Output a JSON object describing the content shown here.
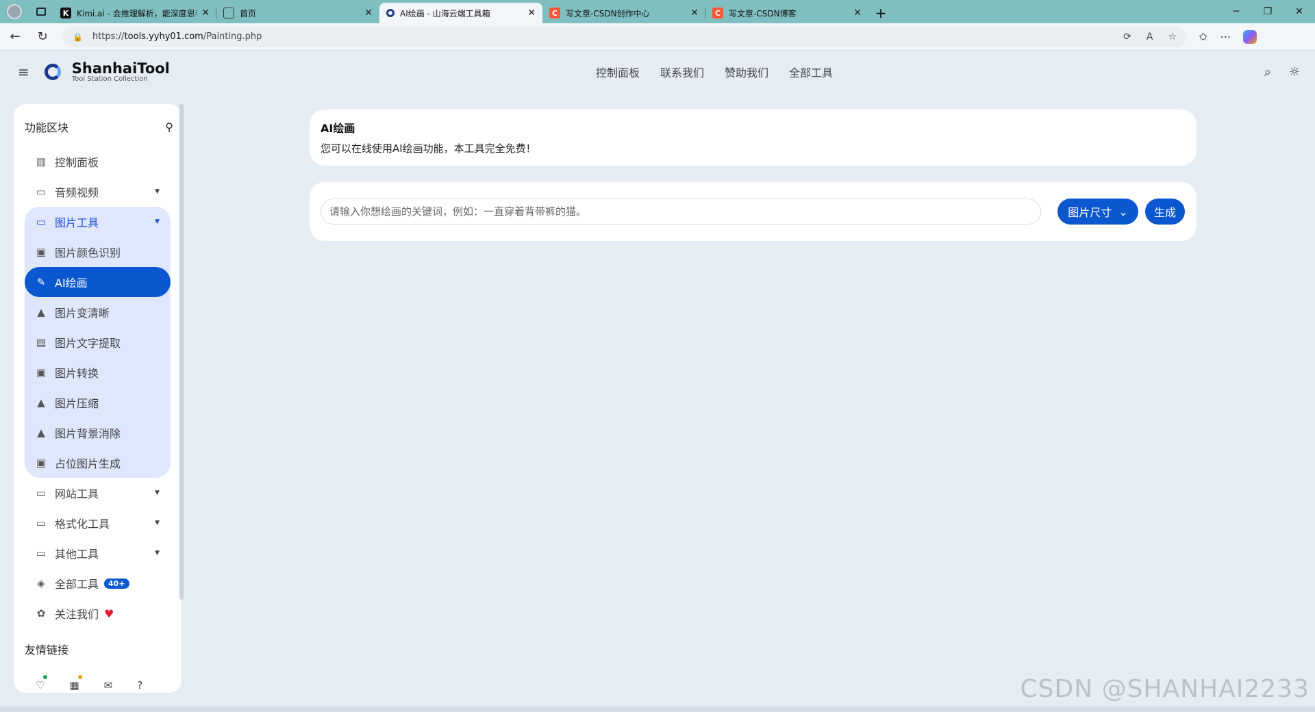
{
  "browser": {
    "tabs": [
      {
        "title": "Kimi.ai - 会推理解析，能深度思考",
        "favicon": "K",
        "favicon_color": "#111111",
        "active": false
      },
      {
        "title": "首页",
        "favicon": "",
        "favicon_color": "#ffffff",
        "active": false
      },
      {
        "title": "AI绘画 - 山海云端工具箱",
        "favicon": "",
        "favicon_color": "#1e3a8a",
        "active": true
      },
      {
        "title": "写文章-CSDN创作中心",
        "favicon": "C",
        "favicon_color": "#fc5531",
        "active": false
      },
      {
        "title": "写文章-CSDN博客",
        "favicon": "C",
        "favicon_color": "#fc5531",
        "active": false
      }
    ],
    "url_prefix": "https://",
    "url_host": "tools.yyhy01.com",
    "url_path": "/Painting.php"
  },
  "header": {
    "logo_name_a": "Shanhai",
    "logo_name_b": "Tool",
    "logo_sub": "Tool Station Collection",
    "nav": [
      "控制面板",
      "联系我们",
      "赞助我们",
      "全部工具"
    ]
  },
  "sidebar": {
    "title": "功能区块",
    "items": {
      "dashboard": "控制面板",
      "audio_video": "音频视频",
      "image_tools": "图片工具",
      "color_detect": "图片颜色识别",
      "ai_paint": "AI绘画",
      "enhance": "图片变清晰",
      "ocr": "图片文字提取",
      "convert": "图片转换",
      "compress": "图片压缩",
      "bg_remove": "图片背景消除",
      "placeholder": "占位图片生成",
      "web_tools": "网站工具",
      "format_tools": "格式化工具",
      "other_tools": "其他工具",
      "all_tools": "全部工具",
      "all_tools_badge": "40+",
      "follow": "关注我们"
    },
    "friends_title": "友情链接"
  },
  "main": {
    "title": "AI绘画",
    "description": "您可以在线使用AI绘画功能，本工具完全免费！",
    "prompt_placeholder": "请输入你想绘画的关键词，例如：一直穿着背带裤的猫。",
    "size_button": "图片尺寸",
    "generate_button": "生成"
  },
  "watermark": "CSDN @SHANHAI2233",
  "colors": {
    "accent": "#0b57d0",
    "page_bg": "#e6ecf4",
    "group_bg": "#dfe7fd"
  }
}
